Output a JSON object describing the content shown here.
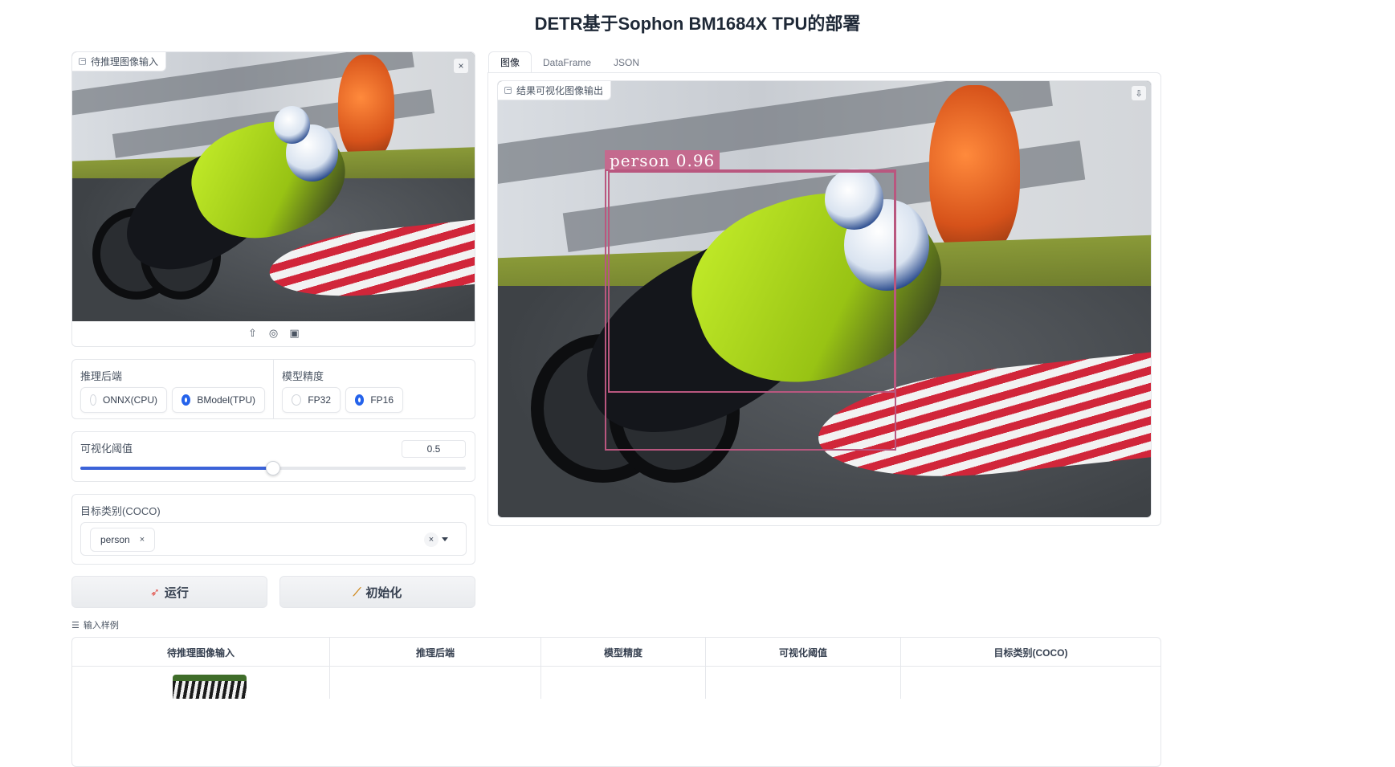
{
  "page": {
    "title": "DETR基于Sophon BM1684X TPU的部署"
  },
  "input_image": {
    "label": "待推理图像输入",
    "close_symbol": "×"
  },
  "backend": {
    "label": "推理后端",
    "options": [
      {
        "label": "ONNX(CPU)",
        "selected": false
      },
      {
        "label": "BModel(TPU)",
        "selected": true
      }
    ]
  },
  "precision": {
    "label": "模型精度",
    "options": [
      {
        "label": "FP32",
        "selected": false
      },
      {
        "label": "FP16",
        "selected": true
      }
    ]
  },
  "threshold": {
    "label": "可视化阈值",
    "value": "0.5",
    "fill_fraction": 0.5
  },
  "classes": {
    "label": "目标类别(COCO)",
    "selected": [
      "person"
    ],
    "remove_symbol": "×",
    "clear_symbol": "×"
  },
  "buttons": {
    "run": "运行",
    "init": "初始化"
  },
  "output": {
    "tabs": [
      {
        "label": "图像",
        "active": true
      },
      {
        "label": "DataFrame",
        "active": false
      },
      {
        "label": "JSON",
        "active": false
      }
    ],
    "image_label": "结果可视化图像输出",
    "detection_label": "person 0.96"
  },
  "examples": {
    "label": "输入样例",
    "headers": [
      "待推理图像输入",
      "推理后端",
      "模型精度",
      "可视化阈值",
      "目标类别(COCO)"
    ]
  },
  "colors": {
    "accent": "#2563eb",
    "bbox": "#b9577f",
    "bbox_label_bg": "#c46a8e"
  }
}
